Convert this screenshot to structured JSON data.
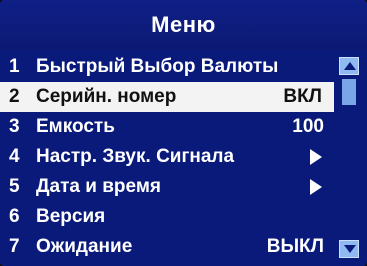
{
  "title": "Меню",
  "menu": {
    "items": [
      {
        "number": "1",
        "label": "Быстрый Выбор Валюты",
        "value": "",
        "has_arrow": false,
        "selected": false
      },
      {
        "number": "2",
        "label": "Серийн. номер",
        "value": "ВКЛ",
        "has_arrow": false,
        "selected": true
      },
      {
        "number": "3",
        "label": "Емкость",
        "value": "100",
        "has_arrow": false,
        "selected": false
      },
      {
        "number": "4",
        "label": "Настр. Звук. Сигнала",
        "value": "",
        "has_arrow": true,
        "selected": false
      },
      {
        "number": "5",
        "label": "Дата и время",
        "value": "",
        "has_arrow": true,
        "selected": false
      },
      {
        "number": "6",
        "label": "Версия",
        "value": "",
        "has_arrow": false,
        "selected": false
      },
      {
        "number": "7",
        "label": "Ожидание",
        "value": "ВЫКЛ",
        "has_arrow": false,
        "selected": false
      }
    ]
  },
  "scrollbar": {
    "position_fraction": 0.0
  },
  "colors": {
    "background": "#0a1a7a",
    "selected_row": "#f3f3f3",
    "text": "#ffffff",
    "scroll_button": "#8fb9f0"
  }
}
